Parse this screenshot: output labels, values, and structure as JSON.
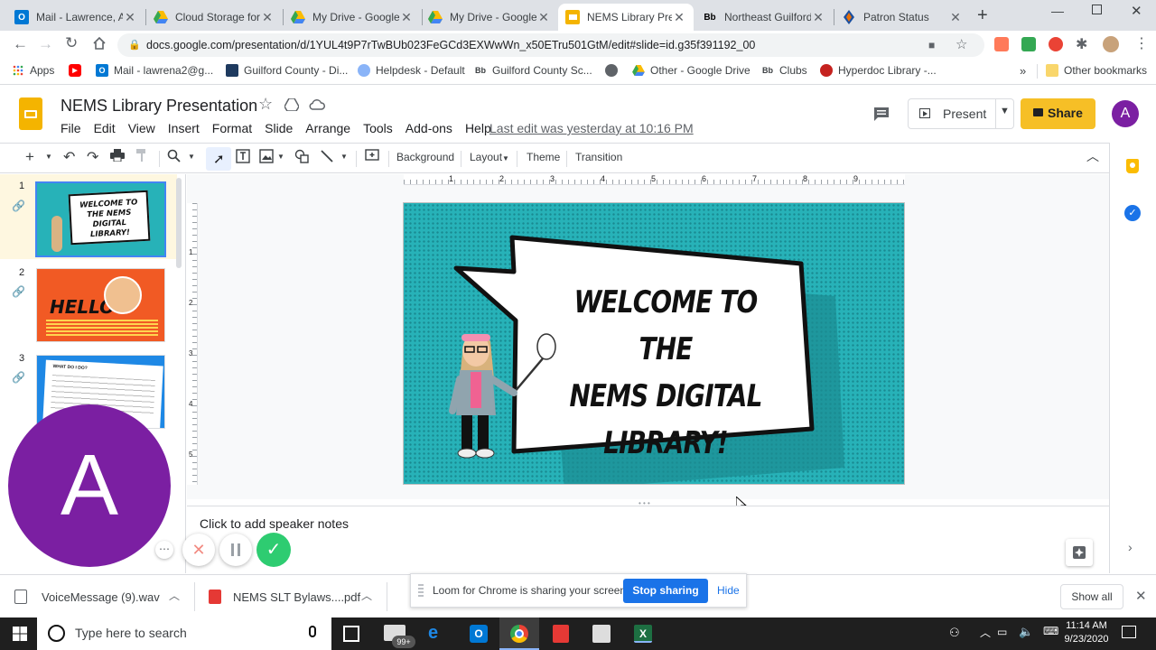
{
  "browser": {
    "tabs": [
      {
        "title": "Mail - Lawrence, A",
        "icon": "outlook-icon"
      },
      {
        "title": "Cloud Storage for",
        "icon": "drive-icon"
      },
      {
        "title": "My Drive - Google",
        "icon": "drive-icon"
      },
      {
        "title": "My Drive - Google",
        "icon": "drive-icon"
      },
      {
        "title": "NEMS Library Pres",
        "icon": "slides-icon"
      },
      {
        "title": "Northeast Guilford",
        "icon": "blackboard-icon"
      },
      {
        "title": "Patron Status",
        "icon": "destiny-icon"
      }
    ],
    "url": "docs.google.com/presentation/d/1YUL4t9P7rTwBUb023FeGCd3EXWwWn_x50ETru501GtM/edit#slide=id.g35f391192_00",
    "bookmarks": [
      {
        "label": "Apps",
        "icon": "apps-grid-icon"
      },
      {
        "label": "",
        "icon": "youtube-icon"
      },
      {
        "label": "Mail - lawrena2@g...",
        "icon": "outlook-icon"
      },
      {
        "label": "Guilford County - Di...",
        "icon": "district-icon"
      },
      {
        "label": "Helpdesk - Default",
        "icon": "helpdesk-icon"
      },
      {
        "label": "Guilford County Sc...",
        "icon": "blackboard-icon"
      },
      {
        "label": "",
        "icon": "globe-icon"
      },
      {
        "label": "Other - Google Drive",
        "icon": "drive-icon"
      },
      {
        "label": "Clubs",
        "icon": "blackboard-icon"
      },
      {
        "label": "Hyperdoc Library -...",
        "icon": "hyperdoc-icon"
      }
    ],
    "other_bookmarks": "Other bookmarks",
    "overflow": "»"
  },
  "slides": {
    "doc_title": "NEMS Library Presentation",
    "menu": [
      "File",
      "Edit",
      "View",
      "Insert",
      "Format",
      "Slide",
      "Arrange",
      "Tools",
      "Add-ons",
      "Help"
    ],
    "last_edit": "Last edit was yesterday at 10:16 PM",
    "present": "Present",
    "share": "Share",
    "avatar_letter": "A",
    "toolbar": {
      "background": "Background",
      "layout": "Layout",
      "theme": "Theme",
      "transition": "Transition"
    },
    "ruler_numbers": [
      "1",
      "2",
      "3",
      "4",
      "5",
      "6",
      "7",
      "8",
      "9"
    ],
    "vruler_numbers": [
      "1",
      "2",
      "3",
      "4",
      "5"
    ],
    "thumbnails": [
      {
        "num": "1",
        "text": "WELCOME TO THE NEMS DIGITAL LIBRARY!"
      },
      {
        "num": "2",
        "text": "HELLO!"
      },
      {
        "num": "3",
        "text": "WHAT DO I DO?"
      }
    ],
    "slide_heading": [
      "WELCOME TO THE",
      "NEMS DIGITAL",
      "LIBRARY!"
    ],
    "speaker_notes": "Click to add speaker notes"
  },
  "loom": {
    "message": "Loom for Chrome is sharing your screen.",
    "stop": "Stop sharing",
    "hide": "Hide",
    "avatar_letter": "A"
  },
  "downloads": {
    "items": [
      {
        "name": "VoiceMessage (9).wav"
      },
      {
        "name": "NEMS SLT Bylaws....pdf"
      }
    ],
    "show_all": "Show all"
  },
  "taskbar": {
    "search_placeholder": "Type here to search",
    "time": "11:14 AM",
    "date": "9/23/2020",
    "badge": "99+"
  },
  "colors": {
    "slide_bg": "#27b2b8",
    "share": "#f6bf26",
    "stop_sharing": "#1a73e8",
    "loom_avatar": "#7b1fa2",
    "thumb2_bg": "#f15a24"
  }
}
